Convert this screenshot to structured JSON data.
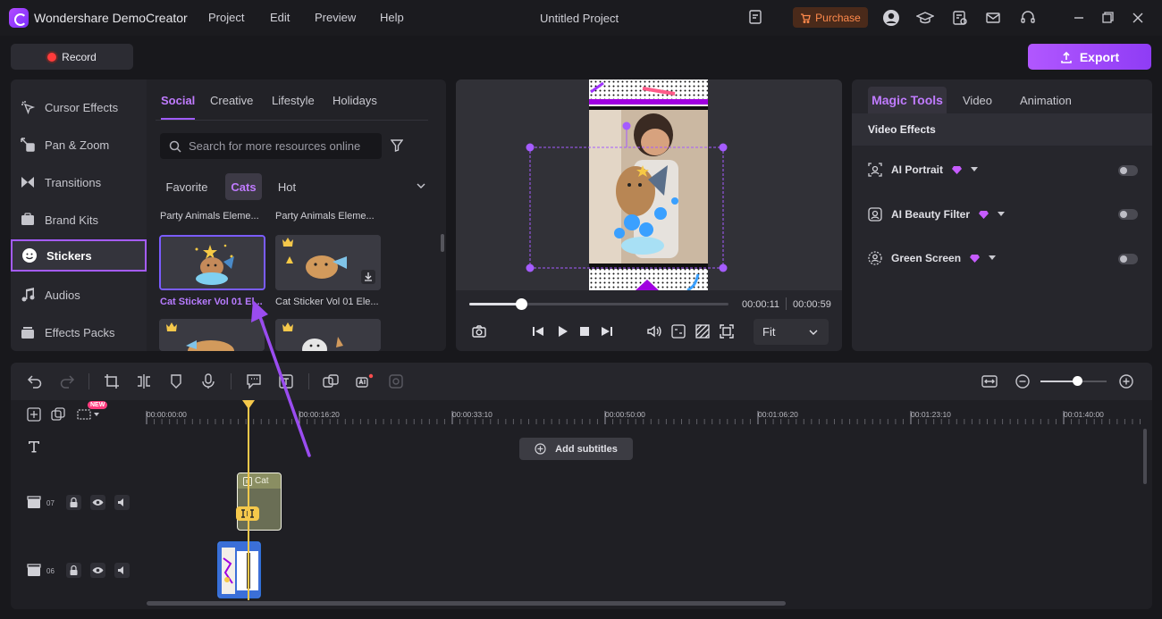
{
  "app": {
    "name": "Wondershare DemoCreator",
    "menu": [
      "Project",
      "Edit",
      "Preview",
      "Help"
    ],
    "project_title": "Untitled Project",
    "purchase_label": "Purchase"
  },
  "actions": {
    "record_label": "Record",
    "export_label": "Export"
  },
  "left_nav": {
    "items": [
      {
        "label": "Cursor Effects",
        "icon": "cursor-effects-icon"
      },
      {
        "label": "Pan & Zoom",
        "icon": "pan-zoom-icon"
      },
      {
        "label": "Transitions",
        "icon": "transitions-icon"
      },
      {
        "label": "Brand Kits",
        "icon": "brand-kits-icon"
      },
      {
        "label": "Stickers",
        "icon": "stickers-icon",
        "active": true
      },
      {
        "label": "Audios",
        "icon": "audio-icon"
      },
      {
        "label": "Effects Packs",
        "icon": "effects-packs-icon"
      }
    ]
  },
  "library": {
    "tabs": [
      "Social",
      "Creative",
      "Lifestyle",
      "Holidays"
    ],
    "active_tab": "Social",
    "search_placeholder": "Search for more resources online",
    "categories": [
      "Favorite",
      "Cats",
      "Hot"
    ],
    "active_category": "Cats",
    "top_labels": [
      "Party Animals Eleme...",
      "Party Animals Eleme..."
    ],
    "items": [
      {
        "label": "Cat Sticker Vol 01 El...",
        "selected": true
      },
      {
        "label": "Cat Sticker Vol 01 Ele...",
        "selected": false
      }
    ]
  },
  "preview": {
    "current_time": "00:00:11",
    "total_time": "00:00:59",
    "progress": 0.2,
    "fit_label": "Fit"
  },
  "right_panel": {
    "tabs": [
      "Magic Tools",
      "Video",
      "Animation"
    ],
    "active_tab": "Magic Tools",
    "section_title": "Video Effects",
    "effects": [
      {
        "label": "AI Portrait",
        "enabled": false
      },
      {
        "label": "AI Beauty Filter",
        "enabled": false
      },
      {
        "label": "Green Screen",
        "enabled": false
      }
    ]
  },
  "timeline": {
    "new_badge": "NEW",
    "ruler": [
      "00:00:00:00",
      "00:00:16:20",
      "00:00:33:10",
      "00:00:50:00",
      "00:01:06:20",
      "00:01:23:10",
      "00:01:40:00"
    ],
    "add_subtitles_label": "Add subtitles",
    "tracks": [
      {
        "number": "07",
        "clip_label": "Cat"
      },
      {
        "number": "06",
        "clip_label": ""
      }
    ],
    "zoom_level": 0.55
  },
  "colors": {
    "accent": "#a55cff",
    "export": "#9b45f8",
    "playhead": "#f5c84b",
    "purchase": "#ff8a4c"
  }
}
